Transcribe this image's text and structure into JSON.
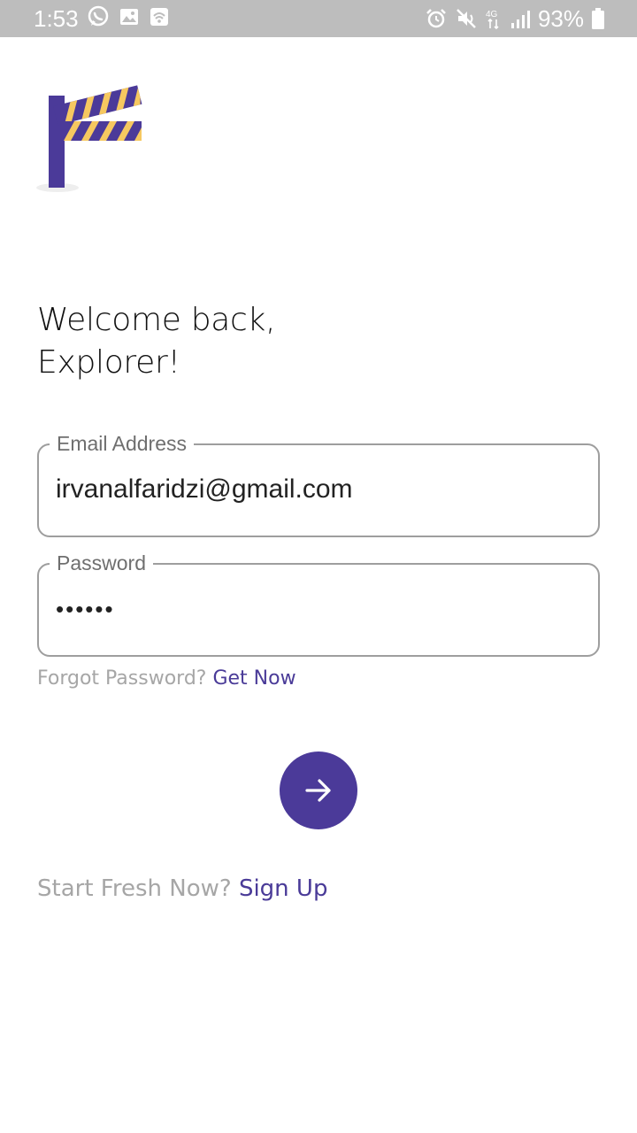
{
  "status_bar": {
    "time": "1:53",
    "battery": "93%",
    "left_icons": [
      "whatsapp-icon",
      "gallery-icon",
      "wifi-hotspot-icon"
    ],
    "right_icons": [
      "alarm-icon",
      "mute-icon",
      "4g-icon",
      "signal-icon",
      "battery-icon"
    ]
  },
  "welcome": {
    "line1": "Welcome back,",
    "line2": "Explorer!"
  },
  "form": {
    "email_label": "Email Address",
    "email_value": "irvanalfaridzi@gmail.com",
    "password_label": "Password",
    "password_value": "••••••"
  },
  "forgot": {
    "prompt": "Forgot Password?",
    "link": "Get Now"
  },
  "signup": {
    "prompt": "Start Fresh Now?",
    "link": "Sign Up"
  },
  "colors": {
    "accent": "#4b3a99",
    "link": "#4a3b98",
    "logo_stripe": "#f6c860",
    "muted_text": "#a6a6a6",
    "status_bar": "#bdbdbd"
  }
}
